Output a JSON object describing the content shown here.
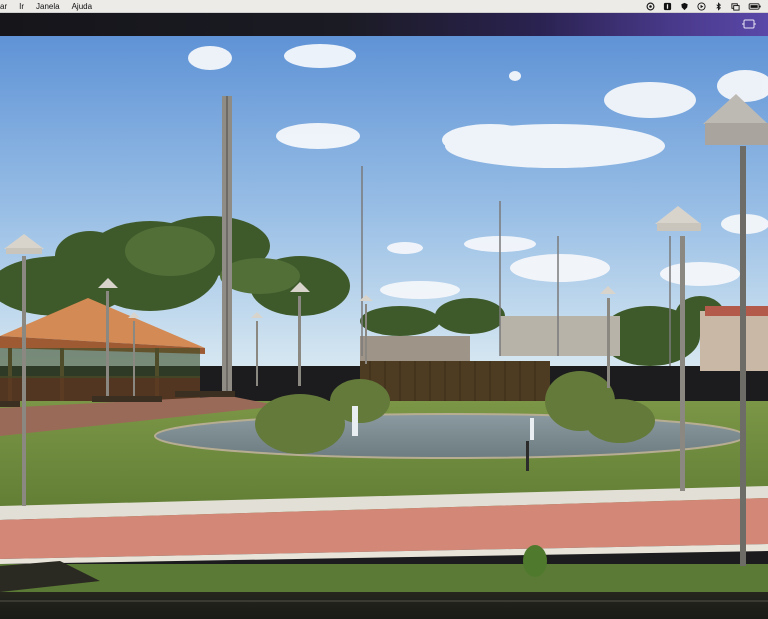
{
  "menubar": {
    "items": [
      "ar",
      "Ir",
      "Janela",
      "Ajuda"
    ],
    "status_icons": [
      "sync-icon",
      "app-icon",
      "shield-icon",
      "play-icon",
      "bluetooth-icon",
      "window-icon",
      "battery-icon"
    ]
  },
  "titlebar": {
    "icon": "picture-in-picture-icon"
  },
  "colors": {
    "sky_top": "#5f93d6",
    "sky_bottom": "#cfe4f3",
    "grass": "#6b8a3c",
    "path": "#d28777",
    "roof": "#d48a52"
  }
}
